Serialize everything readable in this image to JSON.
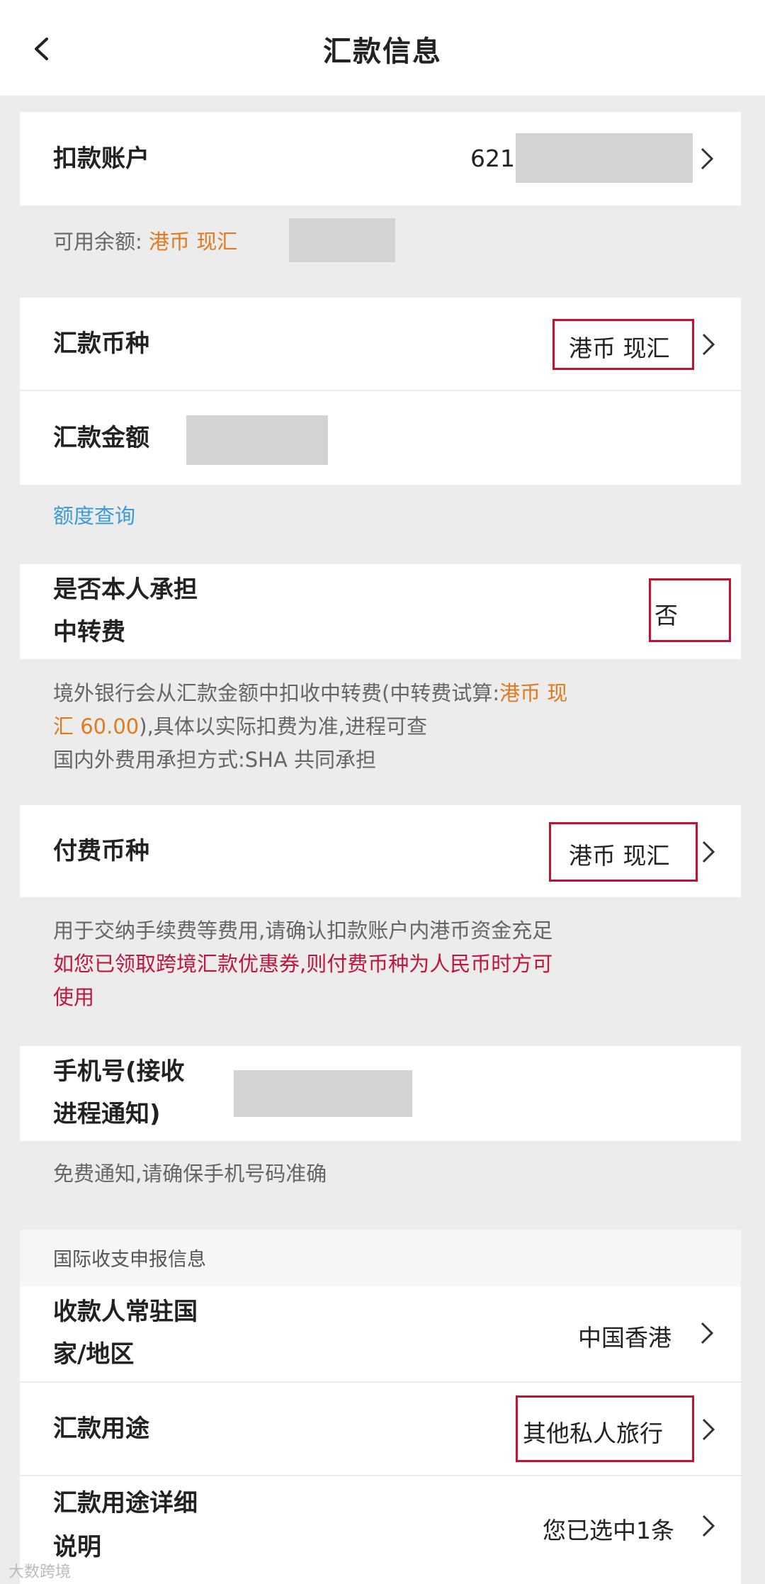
{
  "header": {
    "title": "汇款信息"
  },
  "account": {
    "label": "扣款账户",
    "number_prefix": "621",
    "balance_label": "可用余额:",
    "balance_currency": "港币 现汇"
  },
  "currency": {
    "label": "汇款币种",
    "value": "港币 现汇"
  },
  "amount": {
    "label": "汇款金额",
    "quota_link": "额度查询"
  },
  "transfer_fee": {
    "label_line1": "是否本人承担",
    "label_line2": "中转费",
    "value": "否",
    "note_line1_a": "境外银行会从汇款金额中扣收中转费(中转费试算:",
    "note_line1_b": "港币 现",
    "note_line2_a": "汇 60.00",
    "note_line2_b": "),具体以实际扣费为准,进程可查",
    "note_line3": "国内外费用承担方式:SHA 共同承担"
  },
  "fee_currency": {
    "label": "付费币种",
    "value": "港币 现汇",
    "note_line1": "用于交纳手续费等费用,请确认扣款账户内港币资金充足",
    "note_line2": "如您已领取跨境汇款优惠券,则付费币种为人民币时方可",
    "note_line3": "使用"
  },
  "phone": {
    "label_line1": "手机号(接收",
    "label_line2": "进程通知)",
    "note": "免费通知,请确保手机号码准确"
  },
  "declaration": {
    "section_title": "国际收支申报信息",
    "country_label_line1": "收款人常驻国",
    "country_label_line2": "家/地区",
    "country_value": "中国香港",
    "purpose_label": "汇款用途",
    "purpose_value": "其他私人旅行",
    "detail_label_line1": "汇款用途详细",
    "detail_label_line2": "说明",
    "detail_value": "您已选中1条"
  },
  "watermark": "大数跨境",
  "colors": {
    "accent_orange": "#e07a1f",
    "warning_red": "#c0163d",
    "link_blue": "#3a9bd8",
    "highlight_box": "#c8102e"
  }
}
